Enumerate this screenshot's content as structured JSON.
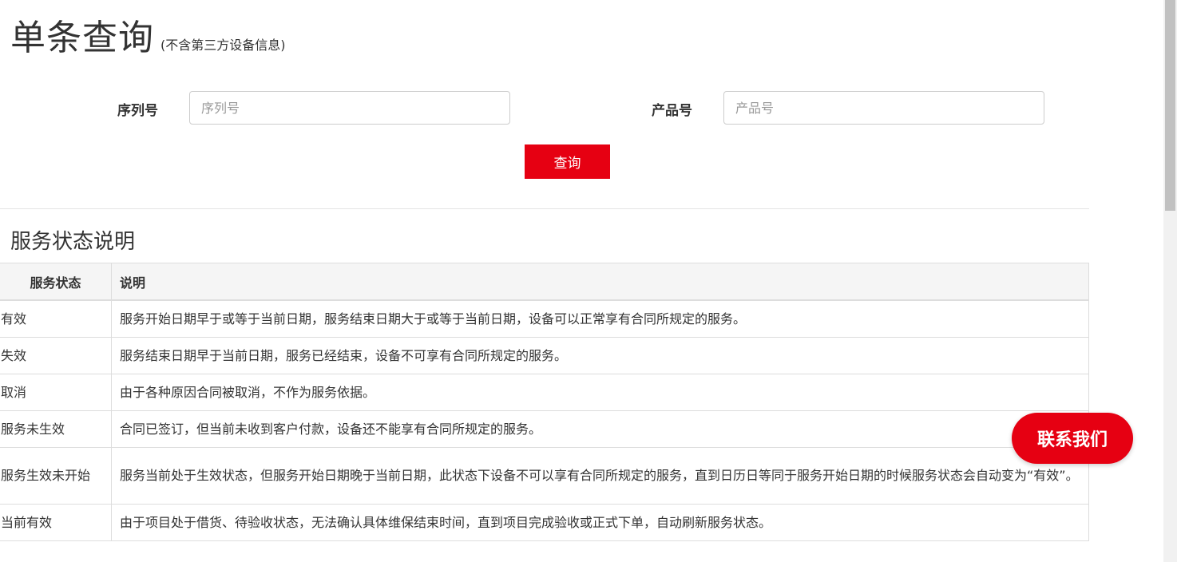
{
  "header": {
    "title": "单条查询",
    "subtitle": "(不含第三方设备信息)"
  },
  "form": {
    "serial_label": "序列号",
    "serial_placeholder": "序列号",
    "serial_value": "",
    "product_label": "产品号",
    "product_placeholder": "产品号",
    "product_value": "",
    "query_label": "查询"
  },
  "status_section": {
    "title": "服务状态说明",
    "columns": [
      "服务状态",
      "说明"
    ],
    "rows": [
      {
        "status": "有效",
        "desc": "服务开始日期早于或等于当前日期，服务结束日期大于或等于当前日期，设备可以正常享有合同所规定的服务。"
      },
      {
        "status": "失效",
        "desc": "服务结束日期早于当前日期，服务已经结束，设备不可享有合同所规定的服务。"
      },
      {
        "status": "取消",
        "desc": "由于各种原因合同被取消，不作为服务依据。"
      },
      {
        "status": "服务未生效",
        "desc": "合同已签订，但当前未收到客户付款，设备还不能享有合同所规定的服务。"
      },
      {
        "status": "服务生效未开始",
        "desc": "服务当前处于生效状态，但服务开始日期晚于当前日期，此状态下设备不可以享有合同所规定的服务，直到日历日等同于服务开始日期的时候服务状态会自动变为“有效”。"
      },
      {
        "status": "当前有效",
        "desc": "由于项目处于借货、待验收状态，无法确认具体维保结束时间，直到项目完成验收或正式下单，自动刷新服务状态。"
      }
    ]
  },
  "contact": {
    "label": "联系我们"
  },
  "colors": {
    "accent": "#e60012"
  }
}
